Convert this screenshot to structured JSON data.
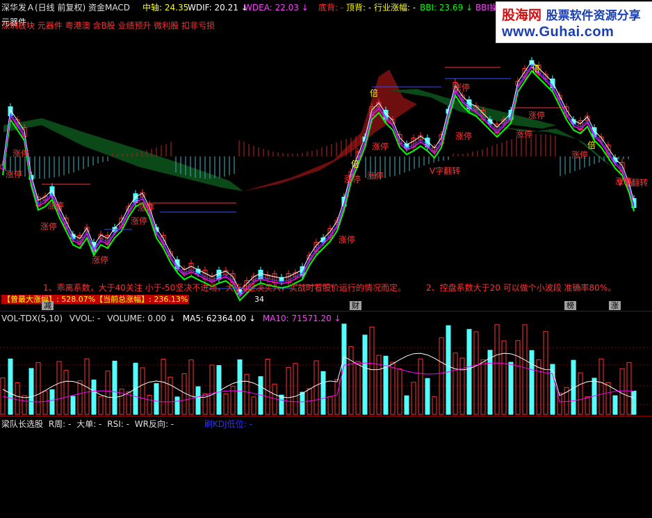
{
  "header": {
    "title": "深华发Ａ(日线 前复权) 资金MACD",
    "zhongzhou_label": "中轴:",
    "zhongzhou_value": "24.35",
    "wdif_label": "WDIF:",
    "wdif_value": "20.21",
    "wdea_label": "WDEA:",
    "wdea_value": "22.03",
    "dibei": "底背: -",
    "dingbei": "顶背: -",
    "hangye": "行业涨幅: -",
    "bbi_label": "BBI:",
    "bbi_value": "23.69",
    "bbi_extra": "BBI操"
  },
  "subheader": {
    "line1": "元器件",
    "line2": "深圳板块 元器件 粤港澳 含B股 业绩预升 微利股 扣非亏损"
  },
  "watermark": {
    "brand": "股海网",
    "slogan": "股票软件资源分享",
    "url": "www.Guhai.com"
  },
  "notes": {
    "line1": "1、乖离系数，大于40关注 小于-50坚决不进场，大于0坚决买入，实战时看股价运行的情况而定。",
    "line2": "2、控盘系数大于20 可以做个小波段 准确率80%。"
  },
  "gain": {
    "label": "【曾最大涨幅】: 528.07%【当前总涨幅】: 236.13%"
  },
  "price_low_label": "34",
  "markers": [
    "减",
    "财",
    "榜",
    "涨"
  ],
  "labels": {
    "limit_up": "涨停",
    "double": "倍",
    "turn": "V字翻转"
  },
  "volume_header": {
    "title": "VOL-TDX(5,10)",
    "vvol": "VVOL: -",
    "volume_label": "VOLUME:",
    "volume_value": "0.00",
    "ma5_label": "MA5:",
    "ma5_value": "62364.00",
    "ma10_label": "MA10:",
    "ma10_value": "71571.20"
  },
  "bottom_header": {
    "title": "梁队长选股",
    "rzhou": "R周: -",
    "dadan": "大单: -",
    "rsi": "RSI: -",
    "wr": "WR反向: -",
    "kdj": "刷KDJ低位: -"
  },
  "colors": {
    "up": "#ff3232",
    "down": "#54fcfc",
    "ma_fast": "#ffffff",
    "ma_mid": "#ff00ff",
    "ma_slow": "#00ff00",
    "yellow": "#ffff00",
    "vol_ma5": "#ffffff",
    "vol_ma10": "#ff00ff"
  }
}
